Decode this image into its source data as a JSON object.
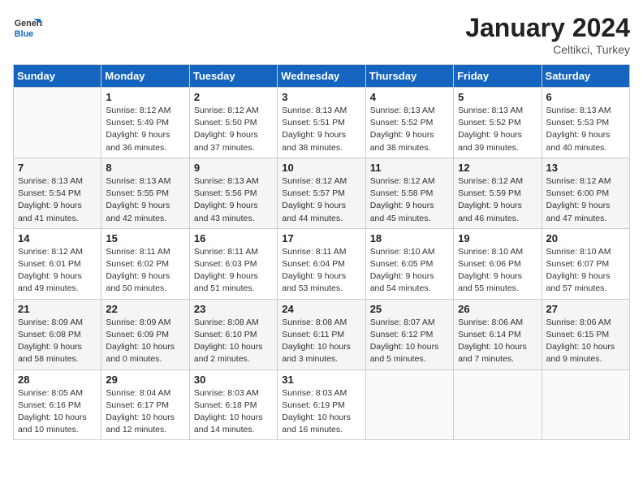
{
  "header": {
    "logo_general": "General",
    "logo_blue": "Blue",
    "main_title": "January 2024",
    "subtitle": "Celtikci, Turkey"
  },
  "calendar": {
    "days_of_week": [
      "Sunday",
      "Monday",
      "Tuesday",
      "Wednesday",
      "Thursday",
      "Friday",
      "Saturday"
    ],
    "weeks": [
      [
        {
          "day": "",
          "info": ""
        },
        {
          "day": "1",
          "info": "Sunrise: 8:12 AM\nSunset: 5:49 PM\nDaylight: 9 hours\nand 36 minutes."
        },
        {
          "day": "2",
          "info": "Sunrise: 8:12 AM\nSunset: 5:50 PM\nDaylight: 9 hours\nand 37 minutes."
        },
        {
          "day": "3",
          "info": "Sunrise: 8:13 AM\nSunset: 5:51 PM\nDaylight: 9 hours\nand 38 minutes."
        },
        {
          "day": "4",
          "info": "Sunrise: 8:13 AM\nSunset: 5:52 PM\nDaylight: 9 hours\nand 38 minutes."
        },
        {
          "day": "5",
          "info": "Sunrise: 8:13 AM\nSunset: 5:52 PM\nDaylight: 9 hours\nand 39 minutes."
        },
        {
          "day": "6",
          "info": "Sunrise: 8:13 AM\nSunset: 5:53 PM\nDaylight: 9 hours\nand 40 minutes."
        }
      ],
      [
        {
          "day": "7",
          "info": "Sunrise: 8:13 AM\nSunset: 5:54 PM\nDaylight: 9 hours\nand 41 minutes."
        },
        {
          "day": "8",
          "info": "Sunrise: 8:13 AM\nSunset: 5:55 PM\nDaylight: 9 hours\nand 42 minutes."
        },
        {
          "day": "9",
          "info": "Sunrise: 8:13 AM\nSunset: 5:56 PM\nDaylight: 9 hours\nand 43 minutes."
        },
        {
          "day": "10",
          "info": "Sunrise: 8:12 AM\nSunset: 5:57 PM\nDaylight: 9 hours\nand 44 minutes."
        },
        {
          "day": "11",
          "info": "Sunrise: 8:12 AM\nSunset: 5:58 PM\nDaylight: 9 hours\nand 45 minutes."
        },
        {
          "day": "12",
          "info": "Sunrise: 8:12 AM\nSunset: 5:59 PM\nDaylight: 9 hours\nand 46 minutes."
        },
        {
          "day": "13",
          "info": "Sunrise: 8:12 AM\nSunset: 6:00 PM\nDaylight: 9 hours\nand 47 minutes."
        }
      ],
      [
        {
          "day": "14",
          "info": "Sunrise: 8:12 AM\nSunset: 6:01 PM\nDaylight: 9 hours\nand 49 minutes."
        },
        {
          "day": "15",
          "info": "Sunrise: 8:11 AM\nSunset: 6:02 PM\nDaylight: 9 hours\nand 50 minutes."
        },
        {
          "day": "16",
          "info": "Sunrise: 8:11 AM\nSunset: 6:03 PM\nDaylight: 9 hours\nand 51 minutes."
        },
        {
          "day": "17",
          "info": "Sunrise: 8:11 AM\nSunset: 6:04 PM\nDaylight: 9 hours\nand 53 minutes."
        },
        {
          "day": "18",
          "info": "Sunrise: 8:10 AM\nSunset: 6:05 PM\nDaylight: 9 hours\nand 54 minutes."
        },
        {
          "day": "19",
          "info": "Sunrise: 8:10 AM\nSunset: 6:06 PM\nDaylight: 9 hours\nand 55 minutes."
        },
        {
          "day": "20",
          "info": "Sunrise: 8:10 AM\nSunset: 6:07 PM\nDaylight: 9 hours\nand 57 minutes."
        }
      ],
      [
        {
          "day": "21",
          "info": "Sunrise: 8:09 AM\nSunset: 6:08 PM\nDaylight: 9 hours\nand 58 minutes."
        },
        {
          "day": "22",
          "info": "Sunrise: 8:09 AM\nSunset: 6:09 PM\nDaylight: 10 hours\nand 0 minutes."
        },
        {
          "day": "23",
          "info": "Sunrise: 8:08 AM\nSunset: 6:10 PM\nDaylight: 10 hours\nand 2 minutes."
        },
        {
          "day": "24",
          "info": "Sunrise: 8:08 AM\nSunset: 6:11 PM\nDaylight: 10 hours\nand 3 minutes."
        },
        {
          "day": "25",
          "info": "Sunrise: 8:07 AM\nSunset: 6:12 PM\nDaylight: 10 hours\nand 5 minutes."
        },
        {
          "day": "26",
          "info": "Sunrise: 8:06 AM\nSunset: 6:14 PM\nDaylight: 10 hours\nand 7 minutes."
        },
        {
          "day": "27",
          "info": "Sunrise: 8:06 AM\nSunset: 6:15 PM\nDaylight: 10 hours\nand 9 minutes."
        }
      ],
      [
        {
          "day": "28",
          "info": "Sunrise: 8:05 AM\nSunset: 6:16 PM\nDaylight: 10 hours\nand 10 minutes."
        },
        {
          "day": "29",
          "info": "Sunrise: 8:04 AM\nSunset: 6:17 PM\nDaylight: 10 hours\nand 12 minutes."
        },
        {
          "day": "30",
          "info": "Sunrise: 8:03 AM\nSunset: 6:18 PM\nDaylight: 10 hours\nand 14 minutes."
        },
        {
          "day": "31",
          "info": "Sunrise: 8:03 AM\nSunset: 6:19 PM\nDaylight: 10 hours\nand 16 minutes."
        },
        {
          "day": "",
          "info": ""
        },
        {
          "day": "",
          "info": ""
        },
        {
          "day": "",
          "info": ""
        }
      ]
    ]
  }
}
